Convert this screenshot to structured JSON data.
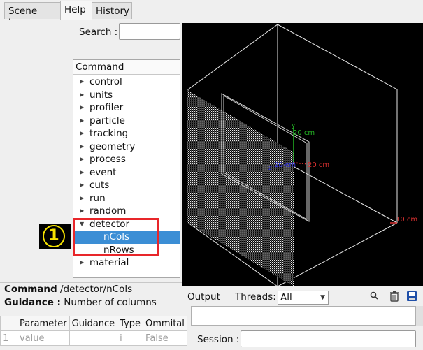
{
  "tabs": [
    {
      "label": "Scene tree"
    },
    {
      "label": "Help"
    },
    {
      "label": "History"
    }
  ],
  "search": {
    "label": "Search :",
    "value": ""
  },
  "tree": {
    "header": "Command",
    "items": [
      {
        "label": "control",
        "expanded": false
      },
      {
        "label": "units",
        "expanded": false
      },
      {
        "label": "profiler",
        "expanded": false
      },
      {
        "label": "particle",
        "expanded": false
      },
      {
        "label": "tracking",
        "expanded": false
      },
      {
        "label": "geometry",
        "expanded": false
      },
      {
        "label": "process",
        "expanded": false
      },
      {
        "label": "event",
        "expanded": false
      },
      {
        "label": "cuts",
        "expanded": false
      },
      {
        "label": "run",
        "expanded": false
      },
      {
        "label": "random",
        "expanded": false
      },
      {
        "label": "detector",
        "expanded": true
      },
      {
        "label": "nCols",
        "child": true,
        "selected": true
      },
      {
        "label": "nRows",
        "child": true
      },
      {
        "label": "material",
        "expanded": false
      }
    ]
  },
  "annotation": {
    "number": "1",
    "color": "#e8262a",
    "badge_color": "#f5e200"
  },
  "viewer": {
    "axes": {
      "y_label": "20 cm",
      "z_label": "20 cm",
      "x_label": "20 cm",
      "y_letter": "y",
      "z_letter": "z"
    },
    "scale_label": "10 cm"
  },
  "help": {
    "command_label": "Command",
    "command_value": "/detector/nCols",
    "guidance_label": "Guidance :",
    "guidance_value": "Number of columns",
    "table": {
      "headers": [
        "",
        "Parameter",
        "Guidance",
        "Type",
        "Ommital"
      ],
      "rows": [
        [
          "1",
          "value",
          "",
          "i",
          "False"
        ]
      ]
    }
  },
  "output": {
    "label": "Output",
    "threads_label": "Threads:",
    "threads_value": "All",
    "session_label": "Session :",
    "session_value": ""
  }
}
